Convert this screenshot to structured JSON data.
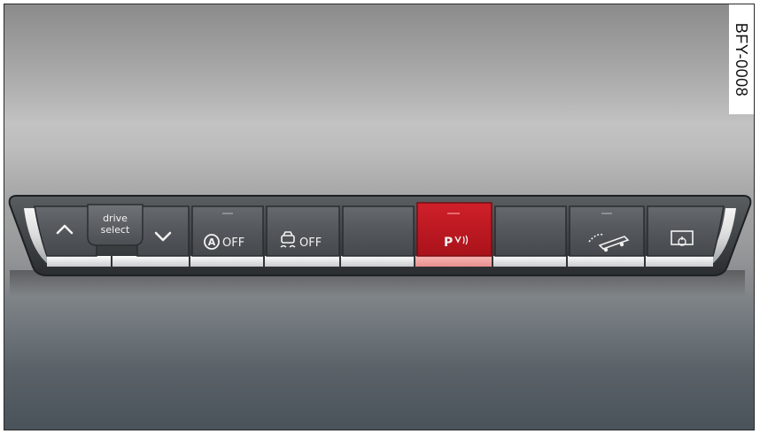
{
  "watermark": "BFY-0008",
  "buttons": [
    {
      "name": "up",
      "icon": "chevron-up-icon"
    },
    {
      "name": "drive-select",
      "line1": "drive",
      "line2": "select"
    },
    {
      "name": "down",
      "icon": "chevron-down-icon"
    },
    {
      "name": "start-stop-off",
      "icon": "auto-start-stop-icon",
      "label": "OFF"
    },
    {
      "name": "esc-off",
      "icon": "traction-control-icon",
      "label": "OFF"
    },
    {
      "name": "blank-left",
      "icon": ""
    },
    {
      "name": "parking",
      "icon": "parking-aid-icon",
      "label": "P",
      "color": "#c8141c"
    },
    {
      "name": "blank-right",
      "icon": ""
    },
    {
      "name": "hill-descent",
      "icon": "hill-descent-icon"
    },
    {
      "name": "display",
      "icon": "display-retract-icon"
    }
  ]
}
